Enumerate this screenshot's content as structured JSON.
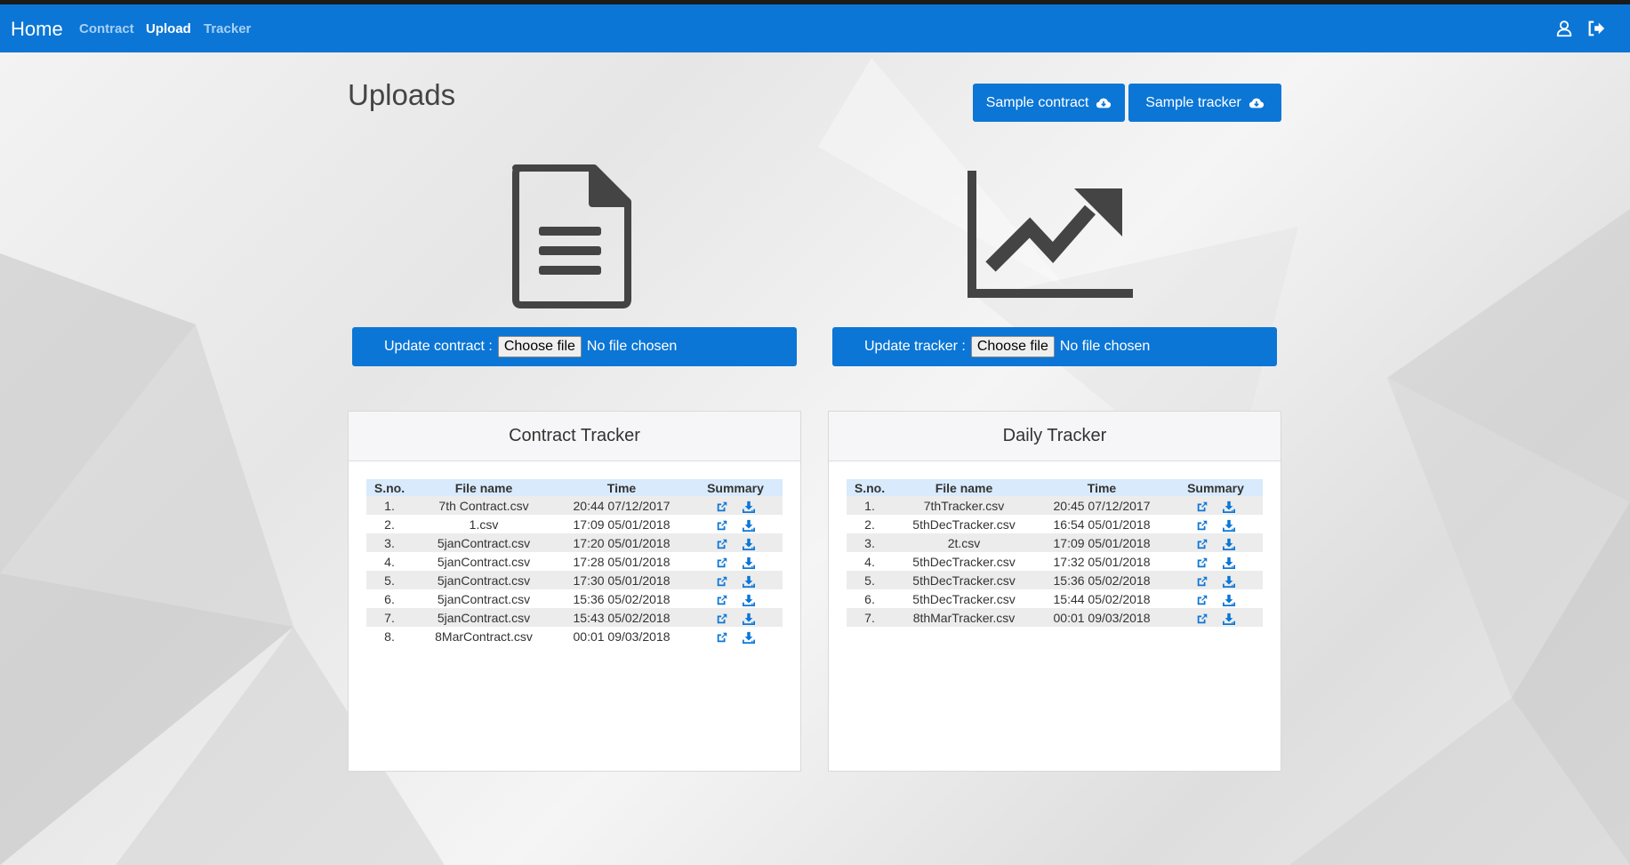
{
  "nav": {
    "brand": "Home",
    "links": [
      "Contract",
      "Upload",
      "Tracker"
    ],
    "right_icons": [
      "user-icon",
      "sign-out-icon"
    ]
  },
  "page": {
    "title": "Uploads",
    "sample_contract_label": "Sample contract",
    "sample_tracker_label": "Sample tracker",
    "big_icons": [
      "document-icon",
      "chart-trend-icon"
    ]
  },
  "uploads": {
    "contract": {
      "label": "Update contract :",
      "button": "Choose file",
      "status": "No file chosen"
    },
    "tracker": {
      "label": "Update tracker :",
      "button": "Choose file",
      "status": "No file chosen"
    }
  },
  "contract_tracker": {
    "title": "Contract Tracker",
    "columns": [
      "S.no.",
      "File name",
      "Time",
      "Summary"
    ],
    "rows": [
      [
        "1.",
        "7th Contract.csv",
        "20:44 07/12/2017"
      ],
      [
        "2.",
        "1.csv",
        "17:09 05/01/2018"
      ],
      [
        "3.",
        "5janContract.csv",
        "17:20 05/01/2018"
      ],
      [
        "4.",
        "5janContract.csv",
        "17:28 05/01/2018"
      ],
      [
        "5.",
        "5janContract.csv",
        "17:30 05/01/2018"
      ],
      [
        "6.",
        "5janContract.csv",
        "15:36 05/02/2018"
      ],
      [
        "7.",
        "5janContract.csv",
        "15:43 05/02/2018"
      ],
      [
        "8.",
        "8MarContract.csv",
        "00:01 09/03/2018"
      ]
    ]
  },
  "daily_tracker": {
    "title": "Daily Tracker",
    "columns": [
      "S.no.",
      "File name",
      "Time",
      "Summary"
    ],
    "rows": [
      [
        "1.",
        "7thTracker.csv",
        "20:45 07/12/2017"
      ],
      [
        "2.",
        "5thDecTracker.csv",
        "16:54 05/01/2018"
      ],
      [
        "3.",
        "2t.csv",
        "17:09 05/01/2018"
      ],
      [
        "4.",
        "5thDecTracker.csv",
        "17:32 05/01/2018"
      ],
      [
        "5.",
        "5thDecTracker.csv",
        "15:36 05/02/2018"
      ],
      [
        "6.",
        "5thDecTracker.csv",
        "15:44 05/02/2018"
      ],
      [
        "7.",
        "8thMarTracker.csv",
        "00:01 09/03/2018"
      ]
    ]
  },
  "colors": {
    "accent": "#0b76d6",
    "icon_dark": "#444444",
    "header_row": "#d8eafb"
  }
}
